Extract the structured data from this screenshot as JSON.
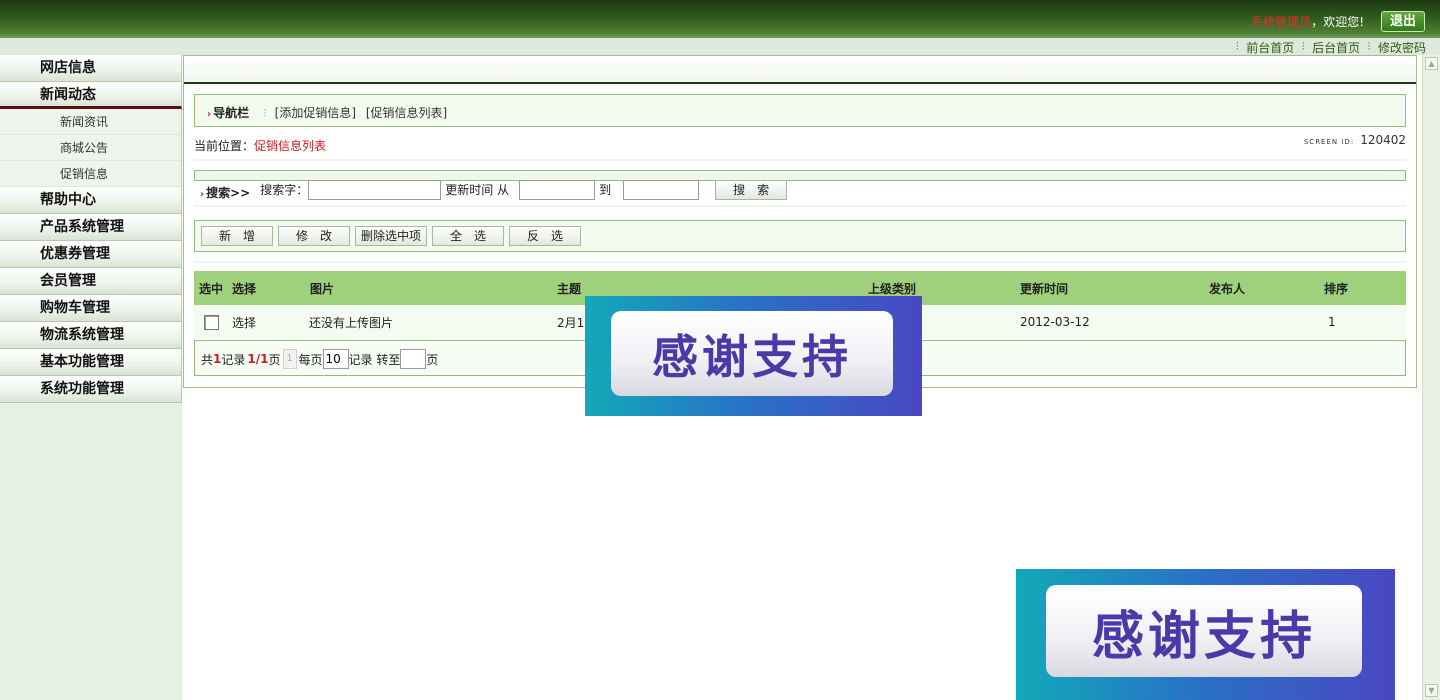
{
  "header": {
    "admin_name": "系统管理员",
    "welcome_text": "，欢迎您!",
    "logout_label": "退出"
  },
  "quick_links": [
    "前台首页",
    "后台首页",
    "修改密码"
  ],
  "sidebar": {
    "items": [
      {
        "label": "网店信息"
      },
      {
        "label": "新闻动态",
        "open": true,
        "children": [
          "新闻资讯",
          "商城公告",
          "促销信息"
        ]
      },
      {
        "label": "帮助中心"
      },
      {
        "label": "产品系统管理"
      },
      {
        "label": "优惠券管理"
      },
      {
        "label": "会员管理"
      },
      {
        "label": "购物车管理"
      },
      {
        "label": "物流系统管理"
      },
      {
        "label": "基本功能管理"
      },
      {
        "label": "系统功能管理"
      }
    ]
  },
  "navbar": {
    "label": "导航栏",
    "links": [
      "[添加促销信息]",
      "[促销信息列表]"
    ]
  },
  "location": {
    "prefix": "当前位置：",
    "current": "促销信息列表"
  },
  "screen_id": {
    "label": "SCREEN ID:",
    "value": "120402"
  },
  "search": {
    "label": "搜索>>",
    "keyword_label": "搜索字：",
    "time_label": "更新时间 从",
    "to_label": "到",
    "button": "搜　索",
    "keyword_value": "",
    "from_value": "",
    "to_value": ""
  },
  "toolbar": {
    "buttons": [
      "新　增",
      "修　改",
      "删除选中项",
      "全　选",
      "反　选"
    ]
  },
  "table": {
    "headers": [
      "选中",
      "选择",
      "图片",
      "主题",
      "上级类别",
      "更新时间",
      "发布人",
      "排序"
    ],
    "rows": [
      [
        "",
        "选择",
        "还没有上传图片",
        "2月1",
        "",
        "2012-03-12",
        "",
        "1"
      ]
    ]
  },
  "pager": {
    "total_prefix": "共",
    "total": "1",
    "total_suffix": "记录",
    "page_current": "1",
    "page_sep": "/",
    "page_total": "1",
    "page_suffix": "页",
    "page_box": "1",
    "per_page_label": "每页",
    "per_page_value": "10",
    "goto_label": "记录 转至",
    "goto_suffix": "页"
  },
  "banners": [
    {
      "text": "感谢支持"
    },
    {
      "text": "感谢支持"
    }
  ]
}
